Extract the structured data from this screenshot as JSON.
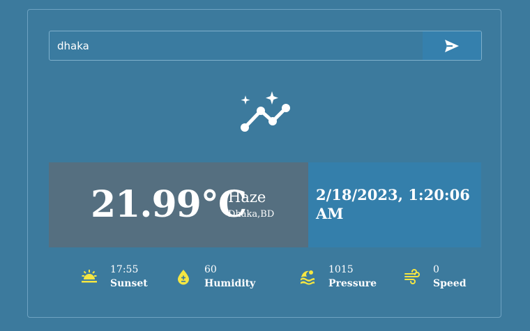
{
  "search": {
    "value": "dhaka"
  },
  "weather": {
    "temperature": "21.99°C",
    "condition": "Haze",
    "location": "Dhaka,BD",
    "datetime": "2/18/2023, 1:20:06 AM"
  },
  "stats": [
    {
      "value": "17:55",
      "label": "Sunset",
      "icon": "sunset-icon"
    },
    {
      "value": "60",
      "label": "Humidity",
      "icon": "humidity-icon"
    },
    {
      "value": "1015",
      "label": "Pressure",
      "icon": "pressure-icon"
    },
    {
      "value": "0",
      "label": "Speed",
      "icon": "wind-icon"
    }
  ],
  "colors": {
    "background": "#3c7a9d",
    "main_panel": "#556f80",
    "date_panel": "#347fab",
    "stat_icon": "#f5e642"
  }
}
